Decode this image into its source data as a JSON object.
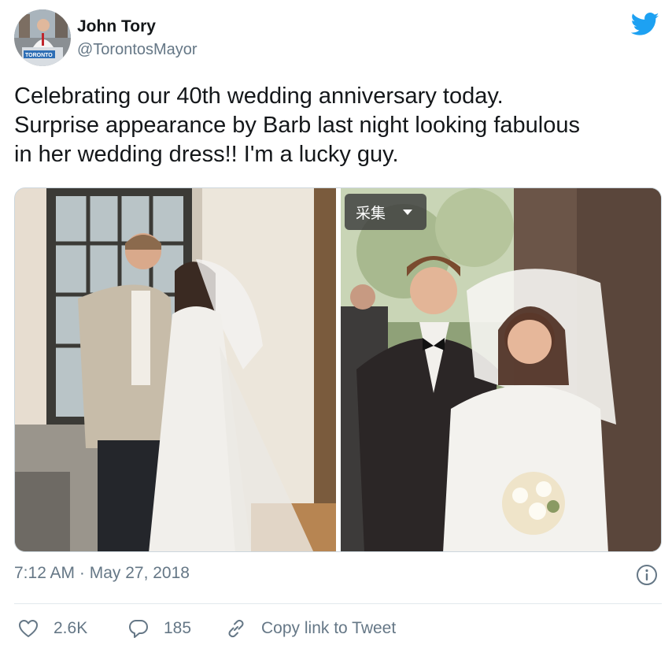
{
  "author": {
    "name": "John Tory",
    "handle": "@TorontosMayor",
    "avatar_podium_text": "TORONTO"
  },
  "tweet": {
    "lines": [
      "Celebrating our 40th wedding anniversary today.",
      "Surprise appearance by Barb last night looking fabulous",
      "in her wedding dress!! I'm a lucky guy."
    ],
    "timestamp": "7:12 AM · May 27, 2018"
  },
  "overlay": {
    "collect_label": "采集"
  },
  "actions": {
    "likes": "2.6K",
    "replies": "185",
    "copy_link_label": "Copy link to Tweet"
  },
  "icons": {
    "brand": "twitter-bird-icon",
    "info": "info-icon",
    "like": "heart-icon",
    "reply": "reply-bubble-icon",
    "link": "link-icon"
  },
  "colors": {
    "twitter_blue": "#1da1f2",
    "text_primary": "#14171a",
    "text_secondary": "#657786",
    "divider": "#e1e8ed"
  }
}
